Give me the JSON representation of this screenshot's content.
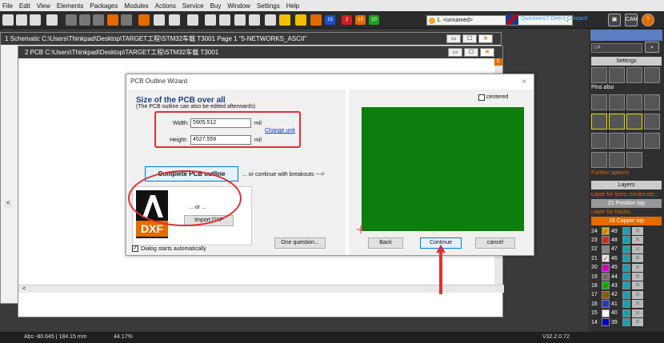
{
  "menu": [
    "File",
    "Edit",
    "View",
    "Elements",
    "Packages",
    "Modules",
    "Actions",
    "Service",
    "Buy",
    "Window",
    "Settings",
    "Help"
  ],
  "toolbar": {
    "combo_value": "1. <unnamed>",
    "question_link": "Questions? Direct Contact!",
    "badges": [
      "15",
      "2",
      "13",
      "10"
    ],
    "cam_label": "CAM"
  },
  "windows": {
    "schematic_title": "1 Schematic C:\\Users\\Thinkpad\\Desktop\\TARGET工程\\STM32车载 T3001 Page 1 \"5-NETWORKS_ASCII\"",
    "pcb_title": "2 PCB C:\\Users\\Thinkpad\\Desktop\\TARGET工程\\STM32车载 T3001",
    "scroll_left": "<",
    "scroll_e": "E"
  },
  "dialog": {
    "title": "PCB Outline Wizard",
    "size_heading": "Size of the PCB over all",
    "size_sub": "(The PCB outline can also be edited afterwards)",
    "width_label": "Width:",
    "width_value": "5905.512",
    "height_label": "Height:",
    "height_value": "4527.559",
    "unit": "mil",
    "change_unit": "Change unit",
    "complete_btn": "Complete PCB outline",
    "breakouts": "... or continue with breakouts --->",
    "or_label": "... or ...",
    "import_dxf": "Import DXF",
    "one_question": "One question...",
    "dialog_auto": "Dialog starts automatically",
    "centered": "centered",
    "back": "Back",
    "continue": "Continue",
    "cancel": "cancel",
    "dxf_text": "DXF"
  },
  "right_panel": {
    "search_value": "U4",
    "settings": "Settings",
    "pins_also": "Pins also",
    "further_options": "Further options",
    "layers": "Layers",
    "layer_hint": "Layer for lines, circles etc.:",
    "layer_value": "21 Position top",
    "track_hint": "Layer for tracks:",
    "track_value": "16 Copper top",
    "layer_rows": [
      {
        "left": "24",
        "right": "49",
        "checked": true,
        "color": "#d4a017"
      },
      {
        "left": "23",
        "right": "48",
        "checked": true,
        "color": "#c0392b"
      },
      {
        "left": "22",
        "right": "47",
        "checked": false,
        "color": "#888888"
      },
      {
        "left": "21",
        "right": "46",
        "checked": true,
        "color": "#e8e8e8"
      },
      {
        "left": "20",
        "right": "45",
        "checked": true,
        "color": "#d000d0"
      },
      {
        "left": "19",
        "right": "44",
        "checked": true,
        "color": "#777777"
      },
      {
        "left": "18",
        "right": "43",
        "checked": true,
        "color": "#00c000"
      },
      {
        "left": "17",
        "right": "42",
        "checked": false,
        "color": "#8b5a00"
      },
      {
        "left": "16",
        "right": "41",
        "checked": true,
        "color": "#1a3fd0"
      },
      {
        "left": "15",
        "right": "40",
        "checked": false,
        "color": "#ffffff"
      },
      {
        "left": "14",
        "right": "39",
        "checked": false,
        "color": "#0000c0"
      }
    ]
  },
  "status": {
    "coords": "Abs -80.645 | 184.15 mm",
    "zoom": "44.17%",
    "version": "V32.2.0.72"
  }
}
